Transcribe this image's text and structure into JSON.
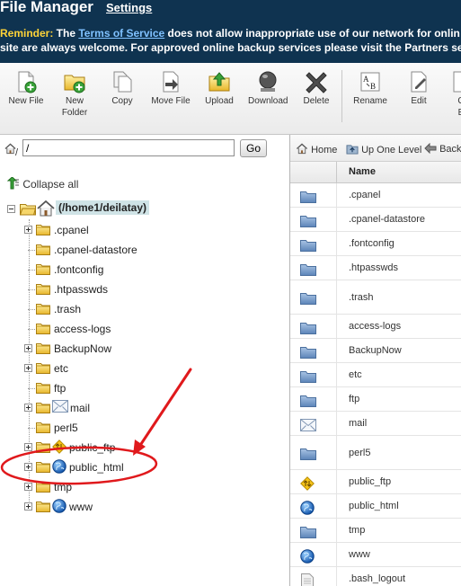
{
  "header": {
    "title": "File Manager",
    "settings_link": "Settings",
    "reminder_label": "Reminder:",
    "reminder_pre": " The ",
    "terms_link": "Terms of Service",
    "reminder_post": " does not allow inappropriate use of our network for onlin",
    "reminder_line2": "site are always welcome. For approved online backup services please visit the Partners se"
  },
  "toolbar": {
    "new_file": "New File",
    "new_folder_1": "New",
    "new_folder_2": "Folder",
    "copy": "Copy",
    "move_file": "Move File",
    "upload": "Upload",
    "download": "Download",
    "delete": "Delete",
    "rename": "Rename",
    "edit": "Edit",
    "code_edit_1": "C",
    "code_edit_2": "E"
  },
  "left_pane": {
    "path_value": "/",
    "go_label": "Go",
    "collapse_all": "Collapse all",
    "root_label": "(/home1/deilatay)",
    "tree": [
      {
        "label": ".cpanel",
        "expandable": true,
        "icon": "folder-icon"
      },
      {
        "label": ".cpanel-datastore",
        "expandable": false,
        "icon": "folder-icon"
      },
      {
        "label": ".fontconfig",
        "expandable": false,
        "icon": "folder-icon"
      },
      {
        "label": ".htpasswds",
        "expandable": false,
        "icon": "folder-icon"
      },
      {
        "label": ".trash",
        "expandable": false,
        "icon": "folder-icon"
      },
      {
        "label": "access-logs",
        "expandable": false,
        "icon": "folder-icon"
      },
      {
        "label": "BackupNow",
        "expandable": true,
        "icon": "folder-icon"
      },
      {
        "label": "etc",
        "expandable": true,
        "icon": "folder-icon"
      },
      {
        "label": "ftp",
        "expandable": false,
        "icon": "folder-icon"
      },
      {
        "label": "mail",
        "expandable": true,
        "icon": "mail-icon"
      },
      {
        "label": "perl5",
        "expandable": false,
        "icon": "folder-icon"
      },
      {
        "label": "public_ftp",
        "expandable": true,
        "icon": "ftp-icon"
      },
      {
        "label": "public_html",
        "expandable": true,
        "icon": "globe-icon"
      },
      {
        "label": "tmp",
        "expandable": true,
        "icon": "folder-icon"
      },
      {
        "label": "www",
        "expandable": true,
        "icon": "globe-icon"
      }
    ]
  },
  "right_pane": {
    "nav_home": "Home",
    "nav_up": "Up One Level",
    "nav_back": "Back",
    "column_name": "Name",
    "files": [
      {
        "name": ".cpanel",
        "icon": "folder-icon"
      },
      {
        "name": ".cpanel-datastore",
        "icon": "folder-icon"
      },
      {
        "name": ".fontconfig",
        "icon": "folder-icon"
      },
      {
        "name": ".htpasswds",
        "icon": "folder-icon"
      },
      {
        "name": ".trash",
        "icon": "folder-icon"
      },
      {
        "name": "access-logs",
        "icon": "folder-icon"
      },
      {
        "name": "BackupNow",
        "icon": "folder-icon"
      },
      {
        "name": "etc",
        "icon": "folder-icon"
      },
      {
        "name": "ftp",
        "icon": "folder-icon"
      },
      {
        "name": "mail",
        "icon": "mail-icon"
      },
      {
        "name": "perl5",
        "icon": "folder-icon"
      },
      {
        "name": "public_ftp",
        "icon": "ftp-icon"
      },
      {
        "name": "public_html",
        "icon": "globe-icon"
      },
      {
        "name": "tmp",
        "icon": "folder-icon"
      },
      {
        "name": "www",
        "icon": "globe-icon"
      },
      {
        "name": ".bash_logout",
        "icon": "file-icon"
      }
    ]
  },
  "colors": {
    "header_bg": "#0f3350",
    "reminder_label": "#ffd338",
    "link": "#7fc1ff",
    "annotation_red": "#e0191c",
    "root_highlight": "#cfe3e6"
  }
}
